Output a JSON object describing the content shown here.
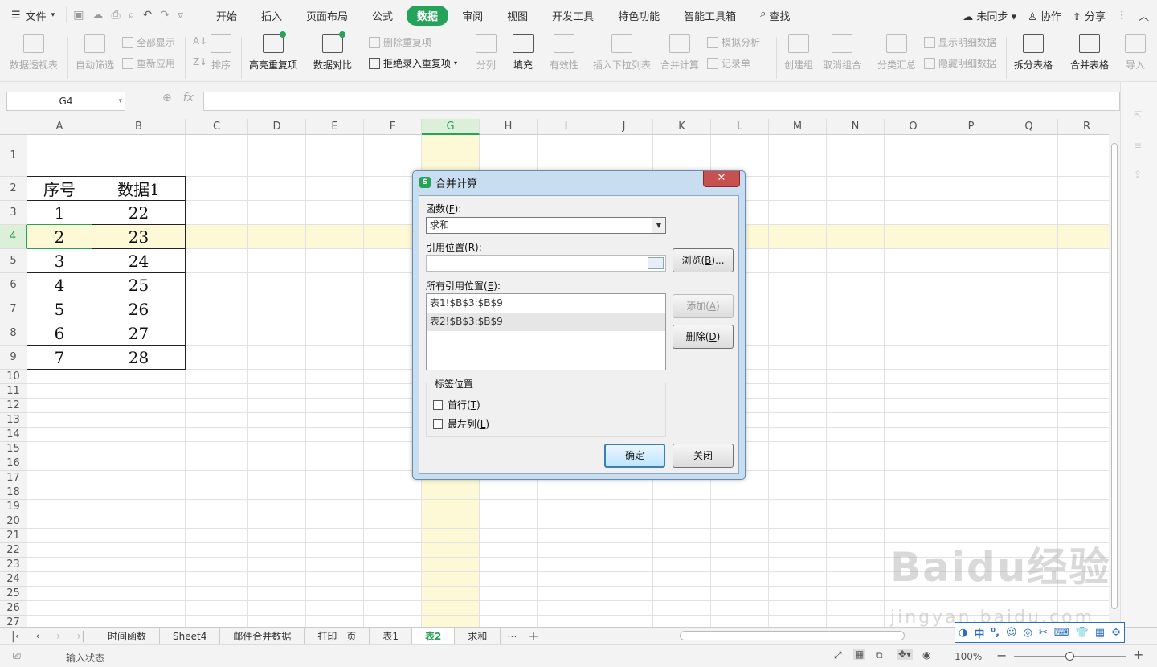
{
  "menu": {
    "file_label": "文件",
    "tabs": [
      "开始",
      "插入",
      "页面布局",
      "公式",
      "数据",
      "审阅",
      "视图",
      "开发工具",
      "特色功能",
      "智能工具箱"
    ],
    "active_tab": "数据",
    "search_label": "查找",
    "sync_label": "未同步",
    "collab_label": "协作",
    "share_label": "分享"
  },
  "ribbon": {
    "pivot": "数据透视表",
    "autofilter": "自动筛选",
    "show_all": "全部显示",
    "reapply": "重新应用",
    "sort": "排序",
    "highlight_dup": "高亮重复项",
    "compare": "数据对比",
    "remove_dup": "删除重复项",
    "reject_dup": "拒绝录入重复项",
    "split": "分列",
    "fill": "填充",
    "validity": "有效性",
    "insert_dropdown": "插入下拉列表",
    "consolidate": "合并计算",
    "simulate": "模拟分析",
    "record": "记录单",
    "create_group": "创建组",
    "ungroup": "取消组合",
    "subtotal": "分类汇总",
    "show_detail": "显示明细数据",
    "hide_detail": "隐藏明细数据",
    "split_table": "拆分表格",
    "merge_table": "合并表格",
    "import": "导入"
  },
  "formula_bar": {
    "name_box": "G4",
    "fx": "fx",
    "value": ""
  },
  "columns": [
    "A",
    "B",
    "C",
    "D",
    "E",
    "F",
    "G",
    "H",
    "I",
    "J",
    "K",
    "L",
    "M",
    "N",
    "O",
    "P",
    "Q",
    "R"
  ],
  "rows": [
    "1",
    "2",
    "3",
    "4",
    "5",
    "6",
    "7",
    "8",
    "9",
    "10",
    "11",
    "12",
    "13",
    "14",
    "15",
    "16",
    "17",
    "18",
    "19",
    "20",
    "21",
    "22",
    "23",
    "24",
    "25",
    "26",
    "27"
  ],
  "table": {
    "headers": [
      "序号",
      "数据1"
    ],
    "rows": [
      [
        "1",
        "22"
      ],
      [
        "2",
        "23"
      ],
      [
        "3",
        "24"
      ],
      [
        "4",
        "25"
      ],
      [
        "5",
        "26"
      ],
      [
        "6",
        "27"
      ],
      [
        "7",
        "28"
      ]
    ]
  },
  "dialog": {
    "title": "合并计算",
    "function_label": "函数",
    "function_key": "F",
    "function_value": "求和",
    "ref_label": "引用位置",
    "ref_key": "R",
    "browse_label": "浏览",
    "browse_key": "B",
    "all_refs_label": "所有引用位置",
    "all_refs_key": "E",
    "refs": [
      "表1!$B$3:$B$9",
      "表2!$B$3:$B$9"
    ],
    "add_label": "添加",
    "add_key": "A",
    "delete_label": "删除",
    "delete_key": "D",
    "label_pos": "标签位置",
    "first_row": "首行",
    "first_row_key": "T",
    "left_col": "最左列",
    "left_col_key": "L",
    "ok_label": "确定",
    "close_label": "关闭"
  },
  "sheets": [
    "时间函数",
    "Sheet4",
    "邮件合并数据",
    "打印一页",
    "表1",
    "表2",
    "求和"
  ],
  "active_sheet": "表2",
  "status": {
    "mode": "输入状态",
    "zoom": "100%"
  },
  "watermark": {
    "line1": "Baidu经验",
    "line2": "jingyan.baidu.com"
  }
}
